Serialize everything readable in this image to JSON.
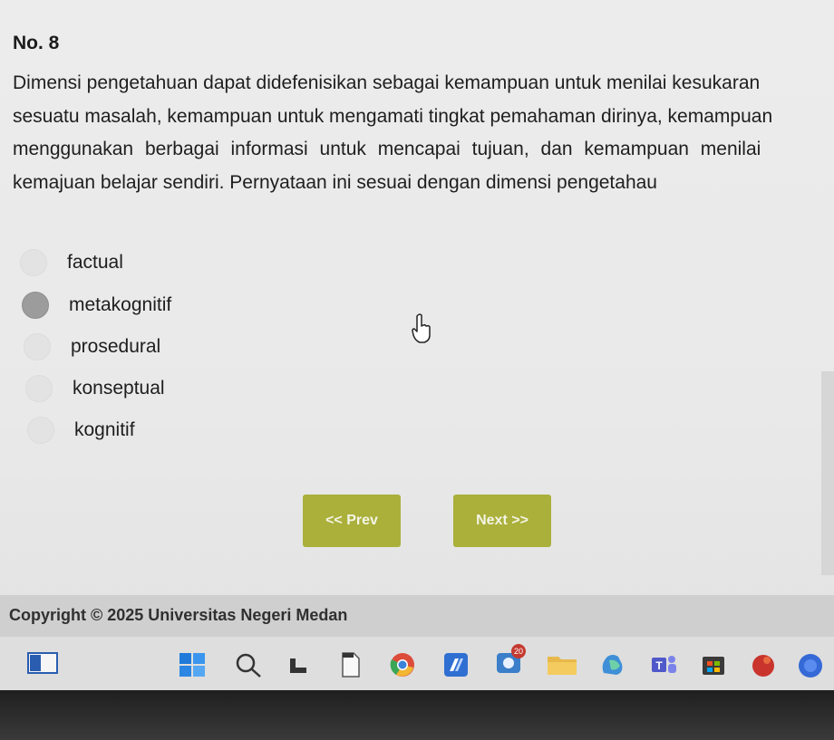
{
  "question": {
    "number": "No. 8",
    "lines": [
      "Dimensi pengetahuan dapat didefenisikan sebagai kemampuan untuk menilai kesukaran",
      "sesuatu masalah, kemampuan untuk mengamati tingkat pemahaman dirinya, kemampuan",
      "menggunakan berbagai informasi untuk mencapai tujuan, dan kemampuan menilai",
      "kemajuan belajar sendiri. Pernyataan ini sesuai dengan dimensi pengetahau"
    ]
  },
  "options": [
    {
      "label": "factual",
      "selected": false
    },
    {
      "label": "metakognitif",
      "selected": true
    },
    {
      "label": "prosedural",
      "selected": false
    },
    {
      "label": "konseptual",
      "selected": false
    },
    {
      "label": "kognitif",
      "selected": false
    }
  ],
  "nav": {
    "prev_label": "<< Prev",
    "next_label": "Next >>",
    "button_color": "#aab03a"
  },
  "footer": {
    "copyright": "Copyright © 2025 Universitas Negeri Medan"
  },
  "taskbar": {
    "icons": [
      "widgets-icon",
      "start-icon",
      "search-icon",
      "task-view-icon",
      "file-icon",
      "chrome-icon",
      "app-icon",
      "camera-icon",
      "folder-icon",
      "copilot-icon",
      "teams-icon",
      "store-icon",
      "app-red-icon",
      "app-blue-icon"
    ],
    "badge_count": "20"
  }
}
